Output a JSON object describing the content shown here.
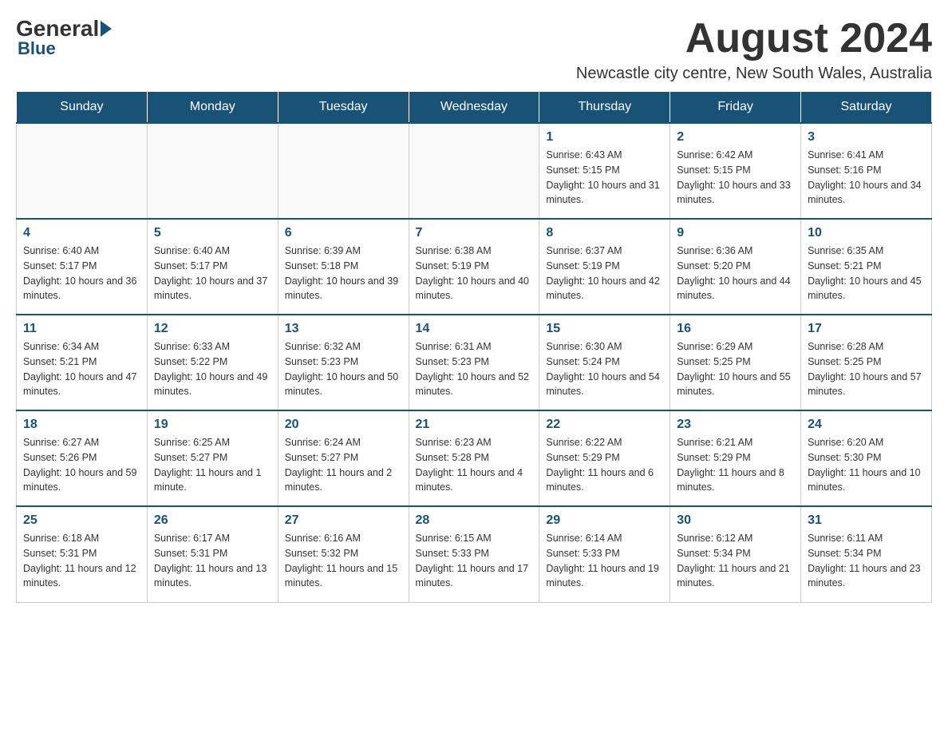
{
  "header": {
    "logo": {
      "general": "General",
      "blue": "Blue"
    },
    "month_title": "August 2024",
    "location": "Newcastle city centre, New South Wales, Australia"
  },
  "days_of_week": [
    "Sunday",
    "Monday",
    "Tuesday",
    "Wednesday",
    "Thursday",
    "Friday",
    "Saturday"
  ],
  "weeks": [
    [
      {
        "day": "",
        "info": ""
      },
      {
        "day": "",
        "info": ""
      },
      {
        "day": "",
        "info": ""
      },
      {
        "day": "",
        "info": ""
      },
      {
        "day": "1",
        "info": "Sunrise: 6:43 AM\nSunset: 5:15 PM\nDaylight: 10 hours and 31 minutes."
      },
      {
        "day": "2",
        "info": "Sunrise: 6:42 AM\nSunset: 5:15 PM\nDaylight: 10 hours and 33 minutes."
      },
      {
        "day": "3",
        "info": "Sunrise: 6:41 AM\nSunset: 5:16 PM\nDaylight: 10 hours and 34 minutes."
      }
    ],
    [
      {
        "day": "4",
        "info": "Sunrise: 6:40 AM\nSunset: 5:17 PM\nDaylight: 10 hours and 36 minutes."
      },
      {
        "day": "5",
        "info": "Sunrise: 6:40 AM\nSunset: 5:17 PM\nDaylight: 10 hours and 37 minutes."
      },
      {
        "day": "6",
        "info": "Sunrise: 6:39 AM\nSunset: 5:18 PM\nDaylight: 10 hours and 39 minutes."
      },
      {
        "day": "7",
        "info": "Sunrise: 6:38 AM\nSunset: 5:19 PM\nDaylight: 10 hours and 40 minutes."
      },
      {
        "day": "8",
        "info": "Sunrise: 6:37 AM\nSunset: 5:19 PM\nDaylight: 10 hours and 42 minutes."
      },
      {
        "day": "9",
        "info": "Sunrise: 6:36 AM\nSunset: 5:20 PM\nDaylight: 10 hours and 44 minutes."
      },
      {
        "day": "10",
        "info": "Sunrise: 6:35 AM\nSunset: 5:21 PM\nDaylight: 10 hours and 45 minutes."
      }
    ],
    [
      {
        "day": "11",
        "info": "Sunrise: 6:34 AM\nSunset: 5:21 PM\nDaylight: 10 hours and 47 minutes."
      },
      {
        "day": "12",
        "info": "Sunrise: 6:33 AM\nSunset: 5:22 PM\nDaylight: 10 hours and 49 minutes."
      },
      {
        "day": "13",
        "info": "Sunrise: 6:32 AM\nSunset: 5:23 PM\nDaylight: 10 hours and 50 minutes."
      },
      {
        "day": "14",
        "info": "Sunrise: 6:31 AM\nSunset: 5:23 PM\nDaylight: 10 hours and 52 minutes."
      },
      {
        "day": "15",
        "info": "Sunrise: 6:30 AM\nSunset: 5:24 PM\nDaylight: 10 hours and 54 minutes."
      },
      {
        "day": "16",
        "info": "Sunrise: 6:29 AM\nSunset: 5:25 PM\nDaylight: 10 hours and 55 minutes."
      },
      {
        "day": "17",
        "info": "Sunrise: 6:28 AM\nSunset: 5:25 PM\nDaylight: 10 hours and 57 minutes."
      }
    ],
    [
      {
        "day": "18",
        "info": "Sunrise: 6:27 AM\nSunset: 5:26 PM\nDaylight: 10 hours and 59 minutes."
      },
      {
        "day": "19",
        "info": "Sunrise: 6:25 AM\nSunset: 5:27 PM\nDaylight: 11 hours and 1 minute."
      },
      {
        "day": "20",
        "info": "Sunrise: 6:24 AM\nSunset: 5:27 PM\nDaylight: 11 hours and 2 minutes."
      },
      {
        "day": "21",
        "info": "Sunrise: 6:23 AM\nSunset: 5:28 PM\nDaylight: 11 hours and 4 minutes."
      },
      {
        "day": "22",
        "info": "Sunrise: 6:22 AM\nSunset: 5:29 PM\nDaylight: 11 hours and 6 minutes."
      },
      {
        "day": "23",
        "info": "Sunrise: 6:21 AM\nSunset: 5:29 PM\nDaylight: 11 hours and 8 minutes."
      },
      {
        "day": "24",
        "info": "Sunrise: 6:20 AM\nSunset: 5:30 PM\nDaylight: 11 hours and 10 minutes."
      }
    ],
    [
      {
        "day": "25",
        "info": "Sunrise: 6:18 AM\nSunset: 5:31 PM\nDaylight: 11 hours and 12 minutes."
      },
      {
        "day": "26",
        "info": "Sunrise: 6:17 AM\nSunset: 5:31 PM\nDaylight: 11 hours and 13 minutes."
      },
      {
        "day": "27",
        "info": "Sunrise: 6:16 AM\nSunset: 5:32 PM\nDaylight: 11 hours and 15 minutes."
      },
      {
        "day": "28",
        "info": "Sunrise: 6:15 AM\nSunset: 5:33 PM\nDaylight: 11 hours and 17 minutes."
      },
      {
        "day": "29",
        "info": "Sunrise: 6:14 AM\nSunset: 5:33 PM\nDaylight: 11 hours and 19 minutes."
      },
      {
        "day": "30",
        "info": "Sunrise: 6:12 AM\nSunset: 5:34 PM\nDaylight: 11 hours and 21 minutes."
      },
      {
        "day": "31",
        "info": "Sunrise: 6:11 AM\nSunset: 5:34 PM\nDaylight: 11 hours and 23 minutes."
      }
    ]
  ]
}
